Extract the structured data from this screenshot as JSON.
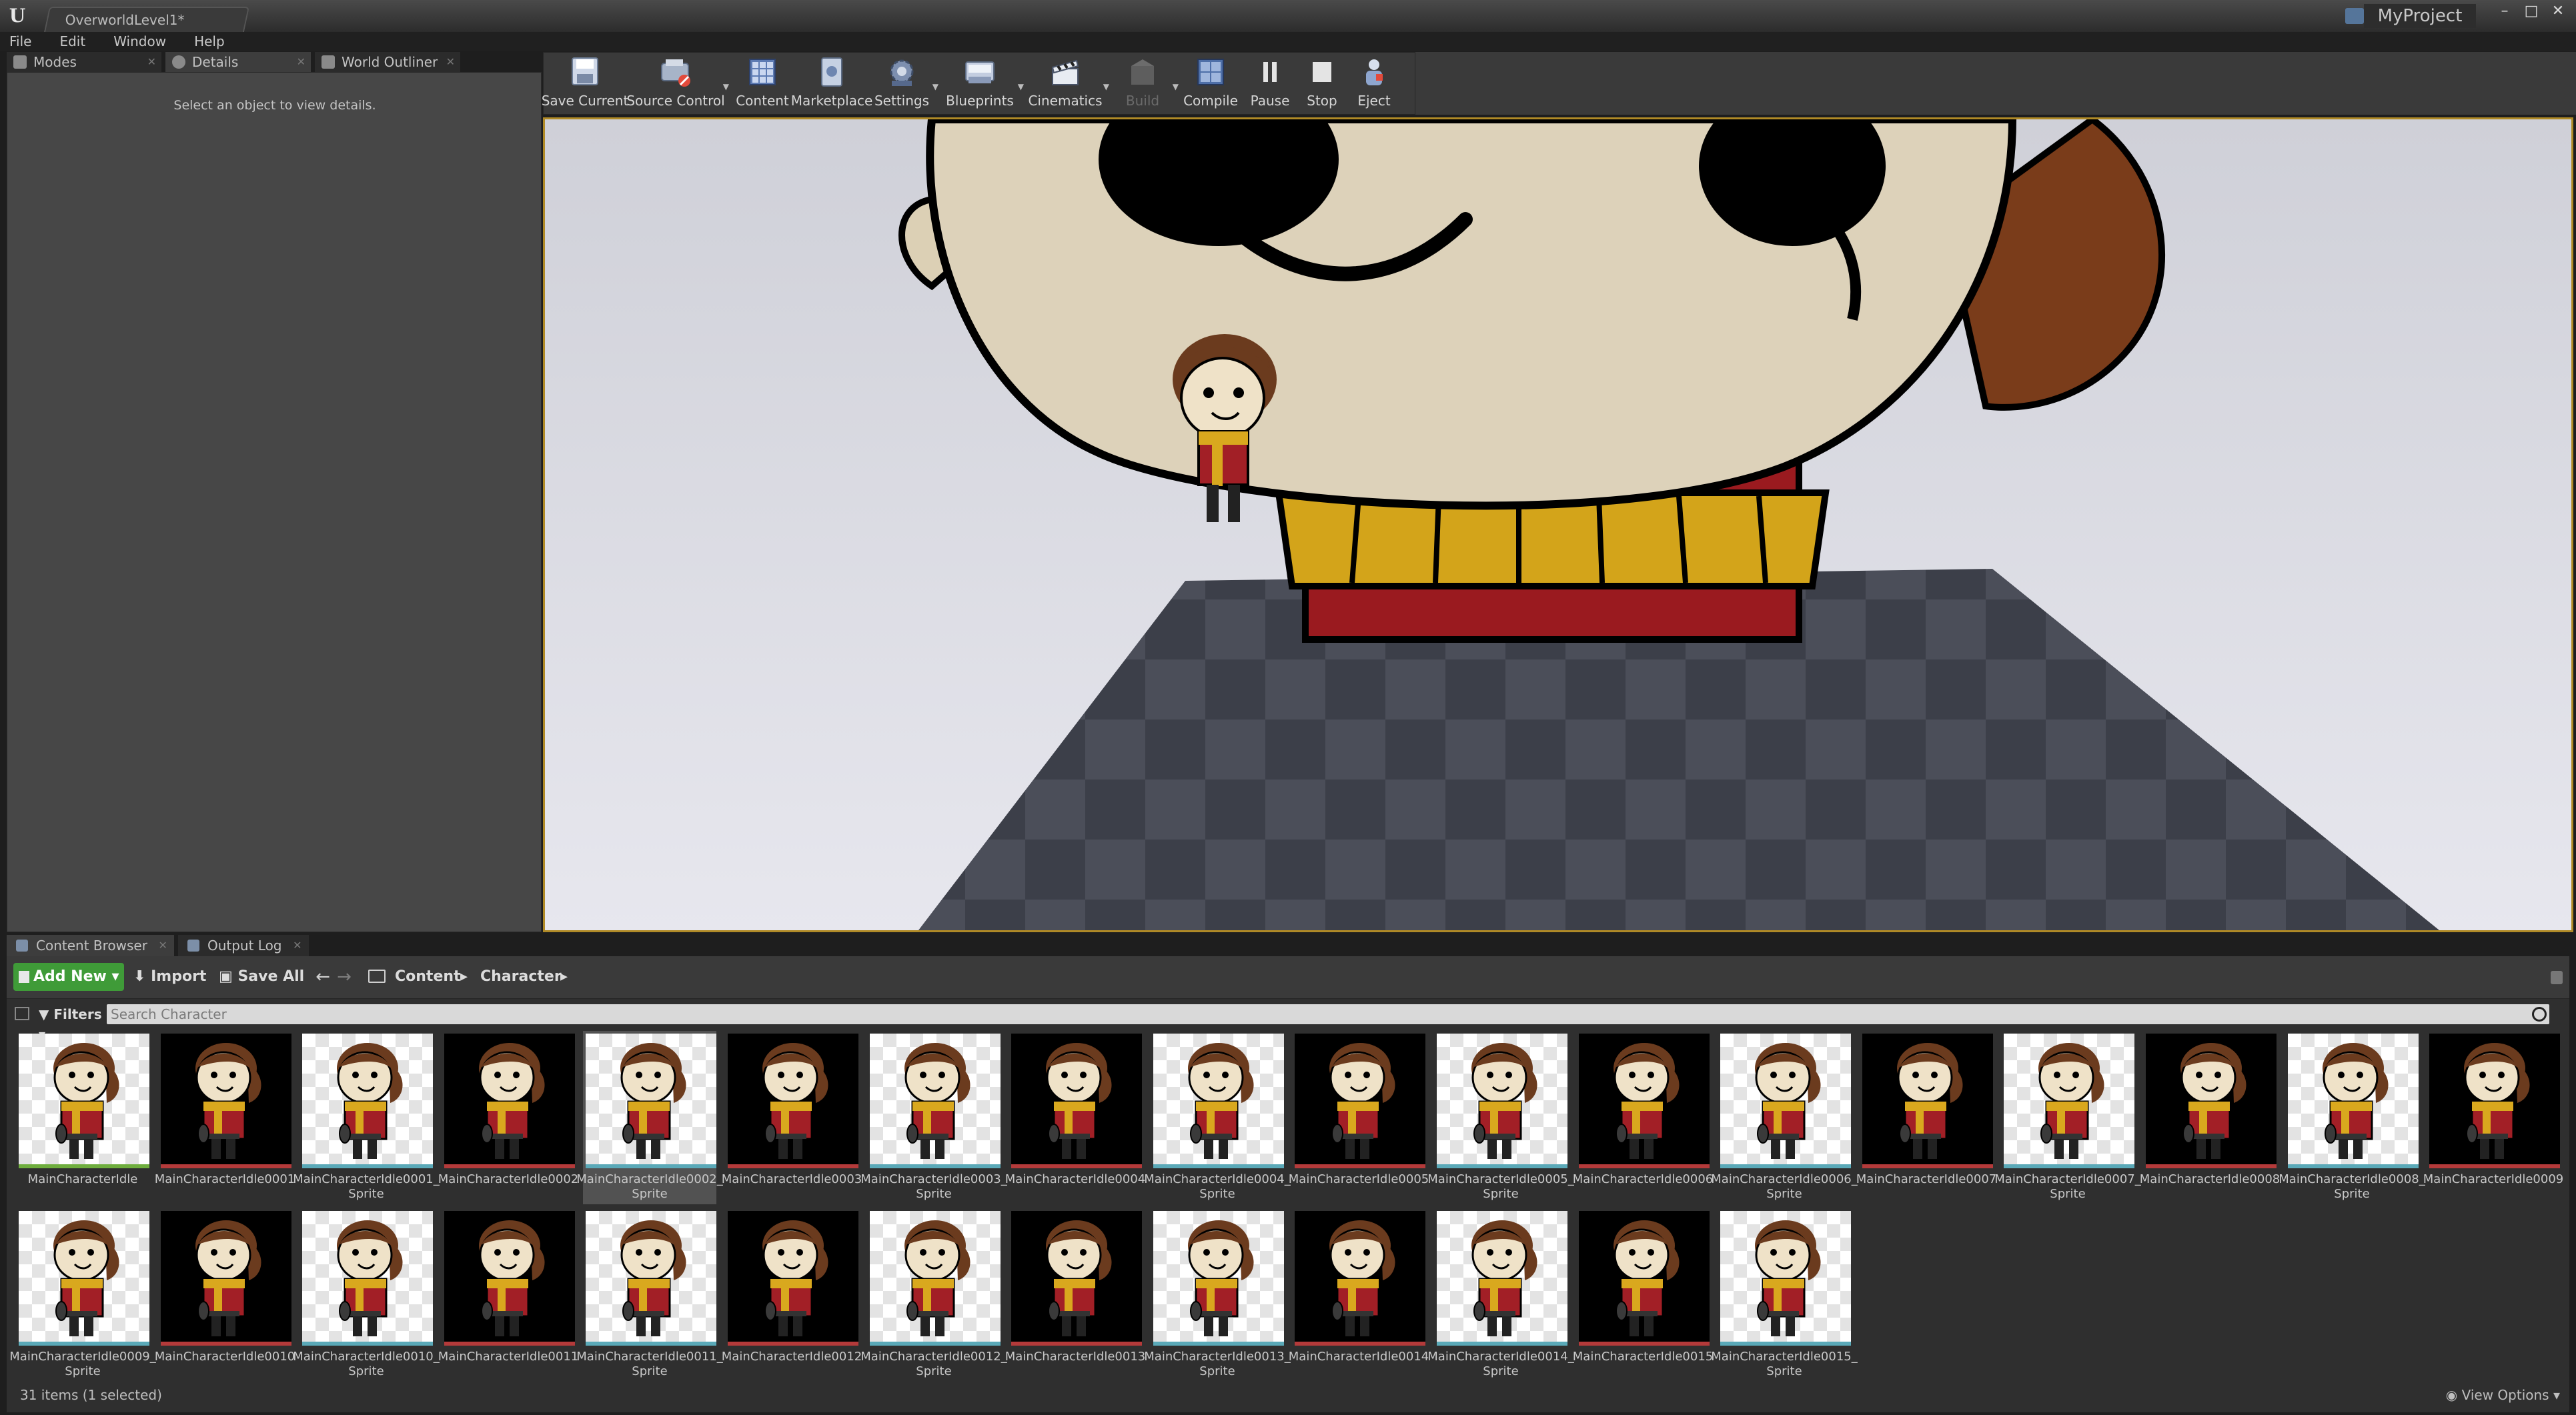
{
  "window": {
    "level_tab": "OverworldLevel1*",
    "project_name": "MyProject",
    "minimize": "–",
    "maximize": "□",
    "close": "✕"
  },
  "menu": [
    "File",
    "Edit",
    "Window",
    "Help"
  ],
  "left_tabs": [
    {
      "label": "Modes",
      "icon": "modes-icon"
    },
    {
      "label": "Details",
      "icon": "details-icon"
    },
    {
      "label": "World Outliner",
      "icon": "world-outliner-icon"
    }
  ],
  "details_message": "Select an object to view details.",
  "toolbar": [
    {
      "label": "Save Current",
      "icon": "save-icon",
      "dropdown": false,
      "disabled": false
    },
    {
      "label": "Source Control",
      "icon": "source-control-icon",
      "dropdown": true,
      "disabled": false
    },
    {
      "label": "Content",
      "icon": "content-icon",
      "dropdown": false,
      "disabled": false
    },
    {
      "label": "Marketplace",
      "icon": "marketplace-icon",
      "dropdown": false,
      "disabled": false
    },
    {
      "label": "Settings",
      "icon": "settings-icon",
      "dropdown": true,
      "disabled": false
    },
    {
      "label": "Blueprints",
      "icon": "blueprints-icon",
      "dropdown": true,
      "disabled": false
    },
    {
      "label": "Cinematics",
      "icon": "cinematics-icon",
      "dropdown": true,
      "disabled": false
    },
    {
      "label": "Build",
      "icon": "build-icon",
      "dropdown": true,
      "disabled": true
    },
    {
      "label": "Compile",
      "icon": "compile-icon",
      "dropdown": false,
      "disabled": false
    },
    {
      "label": "Pause",
      "icon": "pause-icon",
      "dropdown": false,
      "disabled": false
    },
    {
      "label": "Stop",
      "icon": "stop-icon",
      "dropdown": false,
      "disabled": false
    },
    {
      "label": "Eject",
      "icon": "eject-icon",
      "dropdown": false,
      "disabled": false
    }
  ],
  "bottom_tabs": [
    {
      "label": "Content Browser",
      "icon": "content-browser-icon"
    },
    {
      "label": "Output Log",
      "icon": "output-log-icon"
    }
  ],
  "content_browser": {
    "add_new": "Add New",
    "import": "Import",
    "save_all": "Save All",
    "path": [
      "Content",
      "Character"
    ],
    "filters": "Filters",
    "search_placeholder": "Search Character",
    "status": "31 items (1 selected)",
    "view_options": "View Options",
    "selected_index": 4
  },
  "assets": [
    {
      "name": "MainCharacterIdle",
      "kind": "tex"
    },
    {
      "name": "MainCharacterIdle0001",
      "kind": "spr"
    },
    {
      "name": "MainCharacterIdle0001_ Sprite",
      "kind": "tex"
    },
    {
      "name": "MainCharacterIdle0002",
      "kind": "spr"
    },
    {
      "name": "MainCharacterIdle0002_ Sprite",
      "kind": "tex"
    },
    {
      "name": "MainCharacterIdle0003",
      "kind": "spr"
    },
    {
      "name": "MainCharacterIdle0003_ Sprite",
      "kind": "tex"
    },
    {
      "name": "MainCharacterIdle0004",
      "kind": "spr"
    },
    {
      "name": "MainCharacterIdle0004_ Sprite",
      "kind": "tex"
    },
    {
      "name": "MainCharacterIdle0005",
      "kind": "spr"
    },
    {
      "name": "MainCharacterIdle0005_ Sprite",
      "kind": "tex"
    },
    {
      "name": "MainCharacterIdle0006",
      "kind": "spr"
    },
    {
      "name": "MainCharacterIdle0006_ Sprite",
      "kind": "tex"
    },
    {
      "name": "MainCharacterIdle0007",
      "kind": "spr"
    },
    {
      "name": "MainCharacterIdle0007_ Sprite",
      "kind": "tex"
    },
    {
      "name": "MainCharacterIdle0008",
      "kind": "spr"
    },
    {
      "name": "MainCharacterIdle0008_ Sprite",
      "kind": "tex"
    },
    {
      "name": "MainCharacterIdle0009",
      "kind": "spr"
    },
    {
      "name": "MainCharacterIdle0009_ Sprite",
      "kind": "tex"
    },
    {
      "name": "MainCharacterIdle0010",
      "kind": "spr"
    },
    {
      "name": "MainCharacterIdle0010_ Sprite",
      "kind": "tex"
    },
    {
      "name": "MainCharacterIdle0011",
      "kind": "spr"
    },
    {
      "name": "MainCharacterIdle0011_ Sprite",
      "kind": "tex"
    },
    {
      "name": "MainCharacterIdle0012",
      "kind": "spr"
    },
    {
      "name": "MainCharacterIdle0012_ Sprite",
      "kind": "tex"
    },
    {
      "name": "MainCharacterIdle0013",
      "kind": "spr"
    },
    {
      "name": "MainCharacterIdle0013_ Sprite",
      "kind": "tex"
    },
    {
      "name": "MainCharacterIdle0014",
      "kind": "spr"
    },
    {
      "name": "MainCharacterIdle0014_ Sprite",
      "kind": "tex"
    },
    {
      "name": "MainCharacterIdle0015",
      "kind": "spr"
    },
    {
      "name": "MainCharacterIdle0015_ Sprite",
      "kind": "tex"
    }
  ],
  "colors": {
    "texture_stripe": "#5aa9b8",
    "first_texture_stripe": "#6fae3e",
    "sprite_stripe": "#b43a3a",
    "accent_button": "#3f9b38",
    "viewport_border": "#b08a26"
  }
}
